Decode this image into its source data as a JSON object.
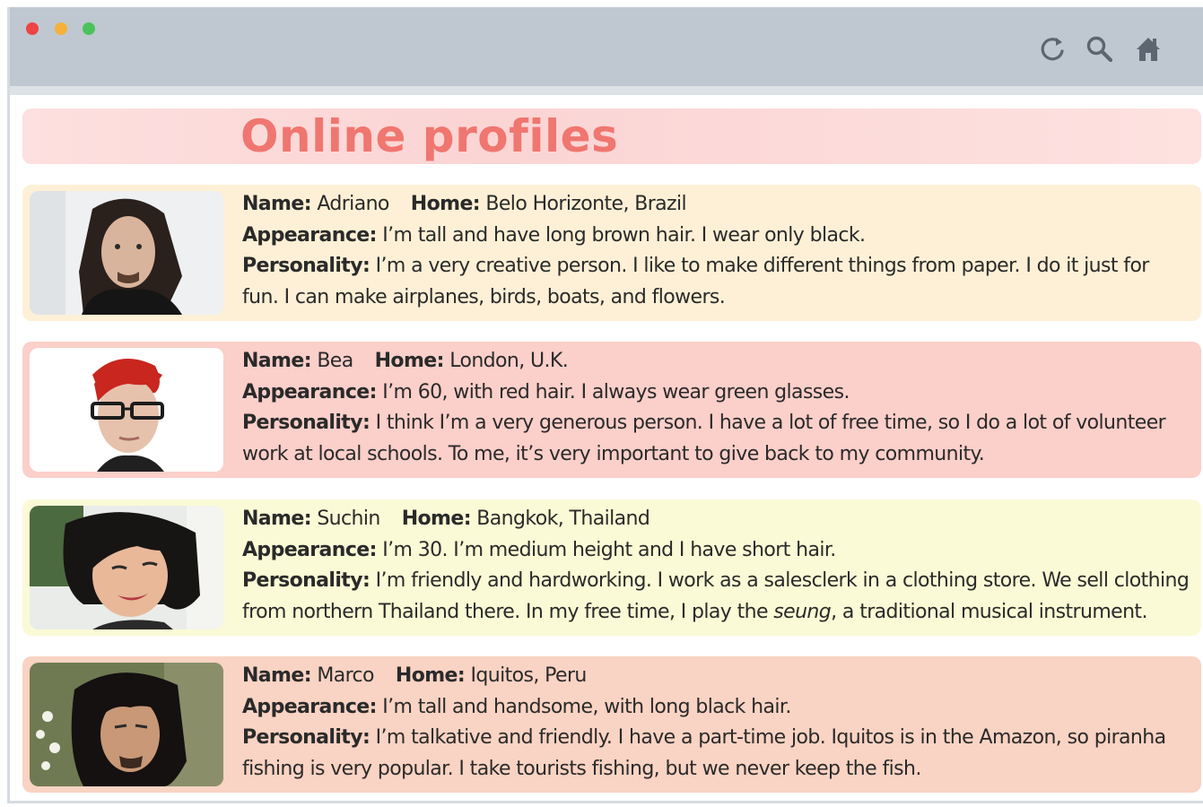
{
  "title": "Online profiles",
  "labels": {
    "name": "Name:",
    "home": "Home:",
    "appearance": "Appearance:",
    "personality": "Personality:"
  },
  "toolbar": {
    "icons": [
      "reload-icon",
      "search-icon",
      "home-icon"
    ]
  },
  "profiles": [
    {
      "name": "Adriano",
      "home": "Belo Horizonte, Brazil",
      "appearance": "I’m tall and have long brown hair. I wear only black.",
      "personality_line1": "I’m a very creative person. I like to make different things from paper. I do it just for",
      "personality_line2": "fun. I can make airplanes, birds, boats, and flowers."
    },
    {
      "name": "Bea",
      "home": "London, U.K.",
      "appearance": "I’m 60, with red hair. I always wear green glasses.",
      "personality_line1": "I think I’m a very generous person. I have a lot of free time, so I do a lot of volunteer",
      "personality_line2": "work at local schools. To me, it’s very important to give back to my community."
    },
    {
      "name": "Suchin",
      "home": "Bangkok, Thailand",
      "appearance": "I’m 30. I’m medium height and I have short hair.",
      "personality_line1": "I’m friendly and hardworking. I work as a salesclerk in a clothing store. We sell clothing",
      "personality_line2_a": "from northern Thailand there. In my free time, I play the ",
      "personality_line2_em": "seung",
      "personality_line2_b": ", a traditional musical instrument."
    },
    {
      "name": "Marco",
      "home": "Iquitos, Peru",
      "appearance": "I’m tall and handsome, with long black hair.",
      "personality_line1": "I’m talkative and friendly. I have a part-time job. Iquitos is in the Amazon, so piranha",
      "personality_line2": "fishing is very popular. I take tourists fishing, but we never keep the fish."
    }
  ],
  "colors": {
    "title": "#f07670",
    "card1": "#fdf0d6",
    "card2": "#fbcfca",
    "card3": "#fafad6",
    "card4": "#f9d3c3"
  }
}
